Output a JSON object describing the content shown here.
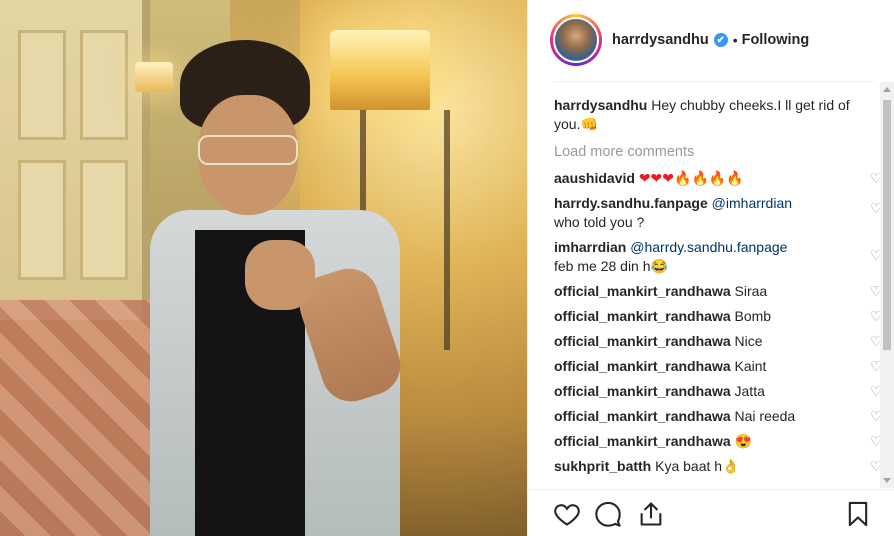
{
  "post": {
    "username": "harrdysandhu",
    "verified_mark": "✔",
    "separator": "•",
    "follow_status": "Following"
  },
  "comments": {
    "caption": {
      "user": "harrdysandhu",
      "text": "Hey chubby cheeks.I ll get rid of you.",
      "emoji": "👊"
    },
    "load_more": "Load more comments",
    "list": [
      {
        "user": "aaushidavid",
        "text": "",
        "hearts": "❤❤❤",
        "fires": "🔥🔥🔥🔥"
      },
      {
        "user": "harrdy.sandhu.fanpage",
        "mention": "@imharrdian",
        "text": "who told you ?"
      },
      {
        "user": "imharrdian",
        "mention": "@harrdy.sandhu.fanpage",
        "text": "feb me 28 din h",
        "emoji": "😂"
      },
      {
        "user": "official_mankirt_randhawa",
        "text": "Siraa"
      },
      {
        "user": "official_mankirt_randhawa",
        "text": "Bomb"
      },
      {
        "user": "official_mankirt_randhawa",
        "text": "Nice"
      },
      {
        "user": "official_mankirt_randhawa",
        "text": "Kaint"
      },
      {
        "user": "official_mankirt_randhawa",
        "text": "Jatta"
      },
      {
        "user": "official_mankirt_randhawa",
        "text": "Nai reeda"
      },
      {
        "user": "official_mankirt_randhawa",
        "text": "",
        "emoji": "😍"
      },
      {
        "user": "sukhprit_batth",
        "text": "Kya baat h",
        "emoji": "👌"
      }
    ],
    "like_glyph": "♡"
  },
  "actions": {
    "icons": [
      "heart-outline-icon",
      "comment-bubble-icon",
      "share-icon",
      "bookmark-icon"
    ]
  },
  "colors": {
    "text": "#262626",
    "muted": "#999999",
    "mention": "#003569",
    "verified": "#3897f0",
    "divider": "#efefef"
  }
}
